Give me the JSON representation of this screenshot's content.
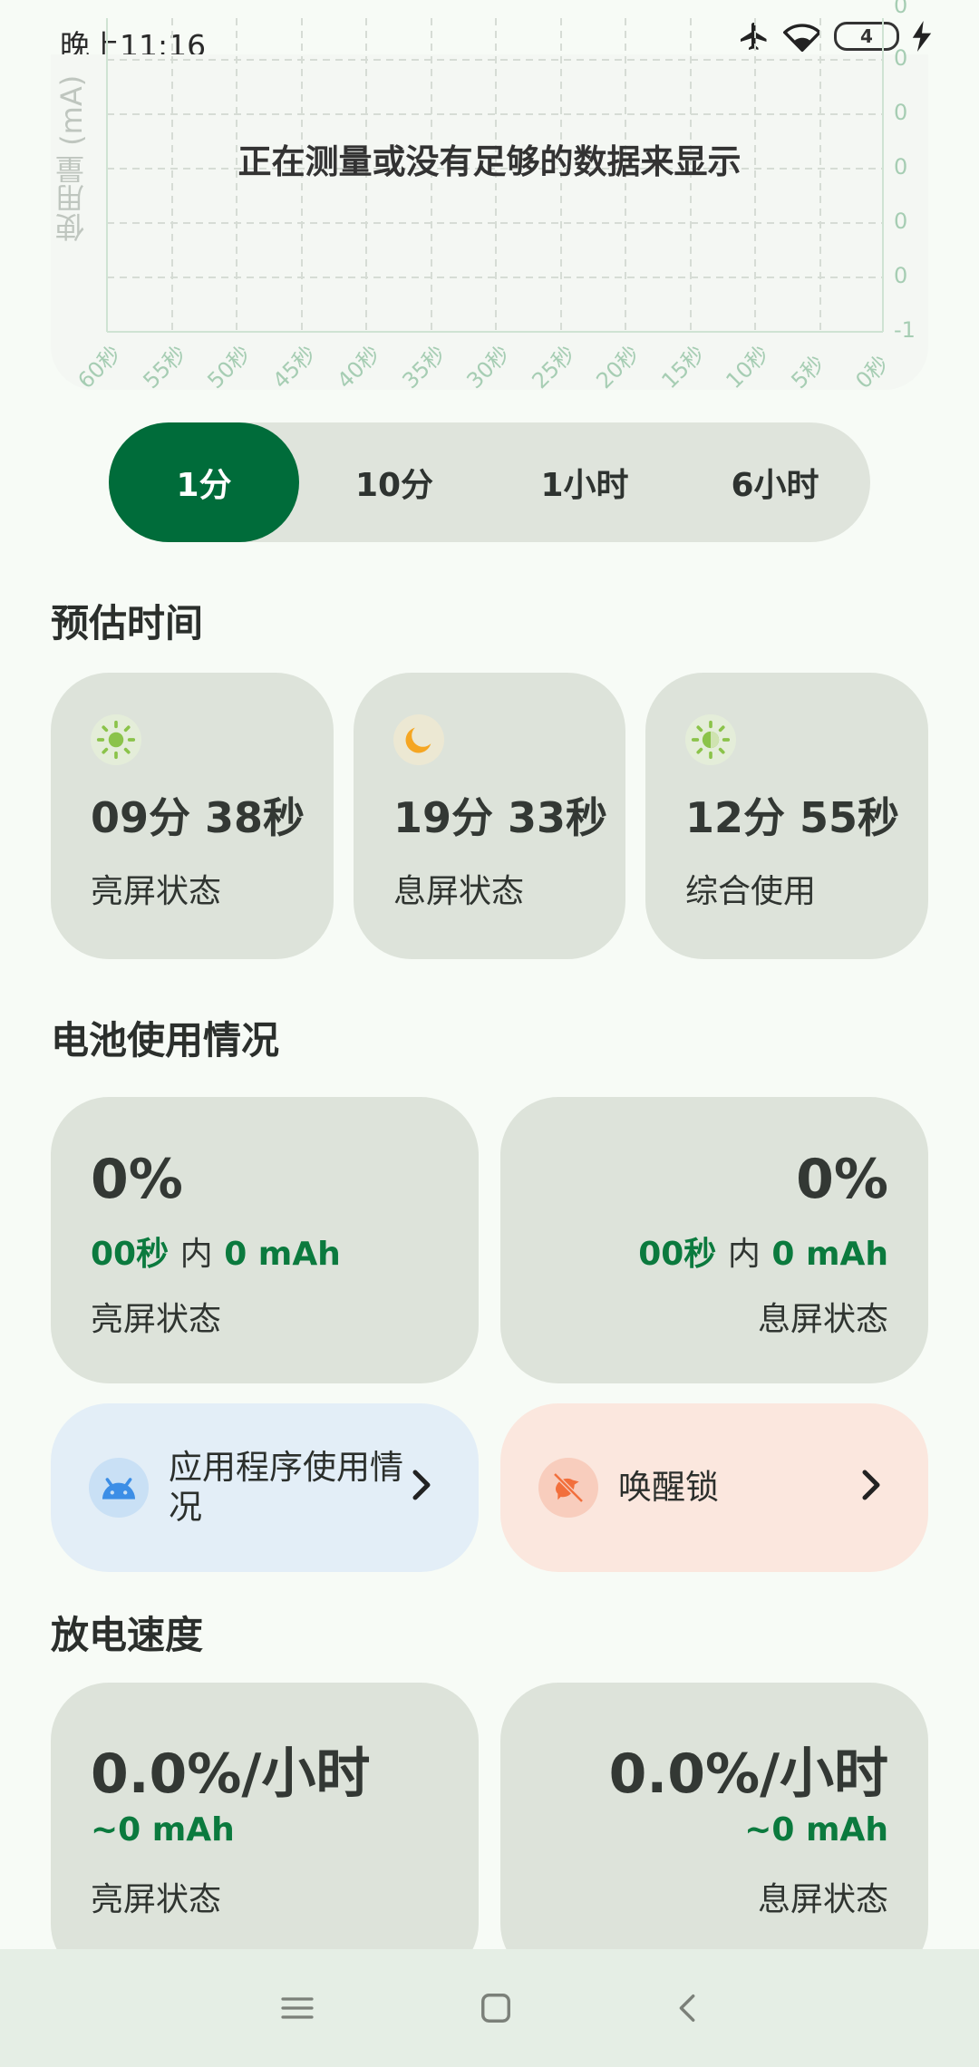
{
  "status_bar": {
    "time": "晚上11:16",
    "battery_level": "4",
    "icons": [
      "airplane-icon",
      "wifi-icon",
      "battery-icon",
      "charging-icon"
    ]
  },
  "graph": {
    "message": "正在测量或没有足够的数据来显示",
    "y_axis_label": "使用量 (mA)",
    "y_ticks": [
      "0",
      "0",
      "0",
      "0",
      "0",
      "0",
      "-1"
    ],
    "x_ticks": [
      "60秒",
      "55秒",
      "50秒",
      "45秒",
      "40秒",
      "35秒",
      "30秒",
      "25秒",
      "20秒",
      "15秒",
      "10秒",
      "5秒",
      "0秒"
    ]
  },
  "range_selector": {
    "options": [
      "1分",
      "10分",
      "1小时",
      "6小时"
    ],
    "selected": "1分"
  },
  "estimated_time": {
    "title": "预估时间",
    "cards": [
      {
        "icon": "sun-icon",
        "value": "09分 38秒",
        "label": "亮屏状态"
      },
      {
        "icon": "moon-icon",
        "value": "19分 33秒",
        "label": "息屏状态"
      },
      {
        "icon": "combined-sun-moon-icon",
        "value": "12分 55秒",
        "label": "综合使用"
      }
    ]
  },
  "battery_usage": {
    "title": "电池使用情况",
    "screen_on": {
      "percent": "0%",
      "duration": "00秒",
      "in_text": "内",
      "amount": "0 mAh",
      "label": "亮屏状态"
    },
    "screen_off": {
      "percent": "0%",
      "duration": "00秒",
      "in_text": "内",
      "amount": "0 mAh",
      "label": "息屏状态"
    },
    "app_usage": {
      "label": "应用程序使用情况",
      "icon": "android-icon"
    },
    "wakelock": {
      "label": "唤醒锁",
      "icon": "wakelock-bird-icon"
    }
  },
  "discharge_rate": {
    "title": "放电速度",
    "screen_on": {
      "rate": "0.0%/小时",
      "amount": "~0 mAh",
      "label": "亮屏状态"
    },
    "screen_off": {
      "rate": "0.0%/小时",
      "amount": "~0 mAh",
      "label": "息屏状态"
    }
  },
  "colors": {
    "accent": "#006c3a",
    "accent_text": "#0b7a3e",
    "card_bg": "#dde3da",
    "app_card_bg": "#e3eef7",
    "wakelock_card_bg": "#fbe7de",
    "sun": "#8bc34a",
    "moon": "#f5a623"
  }
}
